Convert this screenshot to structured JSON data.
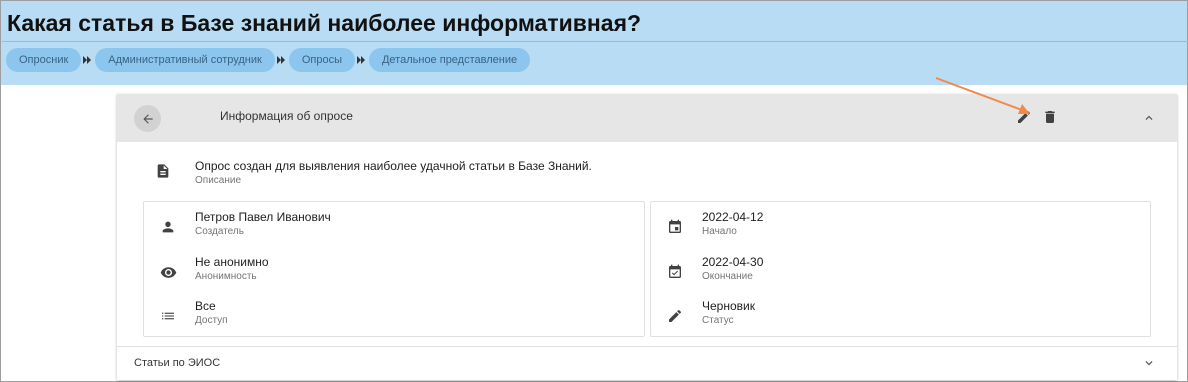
{
  "page": {
    "title": "Какая статья в Базе знаний наиболее информативная?"
  },
  "breadcrumbs": [
    {
      "label": "Опросник"
    },
    {
      "label": "Административный сотрудник"
    },
    {
      "label": "Опросы"
    },
    {
      "label": "Детальное представление"
    }
  ],
  "card": {
    "title": "Информация об опросе",
    "description": {
      "value": "Опрос создан для выявления наиболее удачной статьи в Базе Знаний.",
      "label": "Описание"
    },
    "left": [
      {
        "value": "Петров Павел Иванович",
        "label": "Создатель",
        "icon": "person-icon"
      },
      {
        "value": "Не анонимно",
        "label": "Анонимность",
        "icon": "eye-icon"
      },
      {
        "value": "Все",
        "label": "Доступ",
        "icon": "list-icon"
      }
    ],
    "right": [
      {
        "value": "2022-04-12",
        "label": "Начало",
        "icon": "calendar-icon"
      },
      {
        "value": "2022-04-30",
        "label": "Окончание",
        "icon": "calendar-check-icon"
      },
      {
        "value": "Черновик",
        "label": "Статус",
        "icon": "pencil-icon"
      }
    ]
  },
  "section2": {
    "title": "Статьи по ЭИОС"
  },
  "colors": {
    "header_bg": "#b9dcf5",
    "crumb_bg": "#8cc6ee",
    "card_head_bg": "#e6e6e6",
    "annotation_arrow": "#f08a4b"
  }
}
